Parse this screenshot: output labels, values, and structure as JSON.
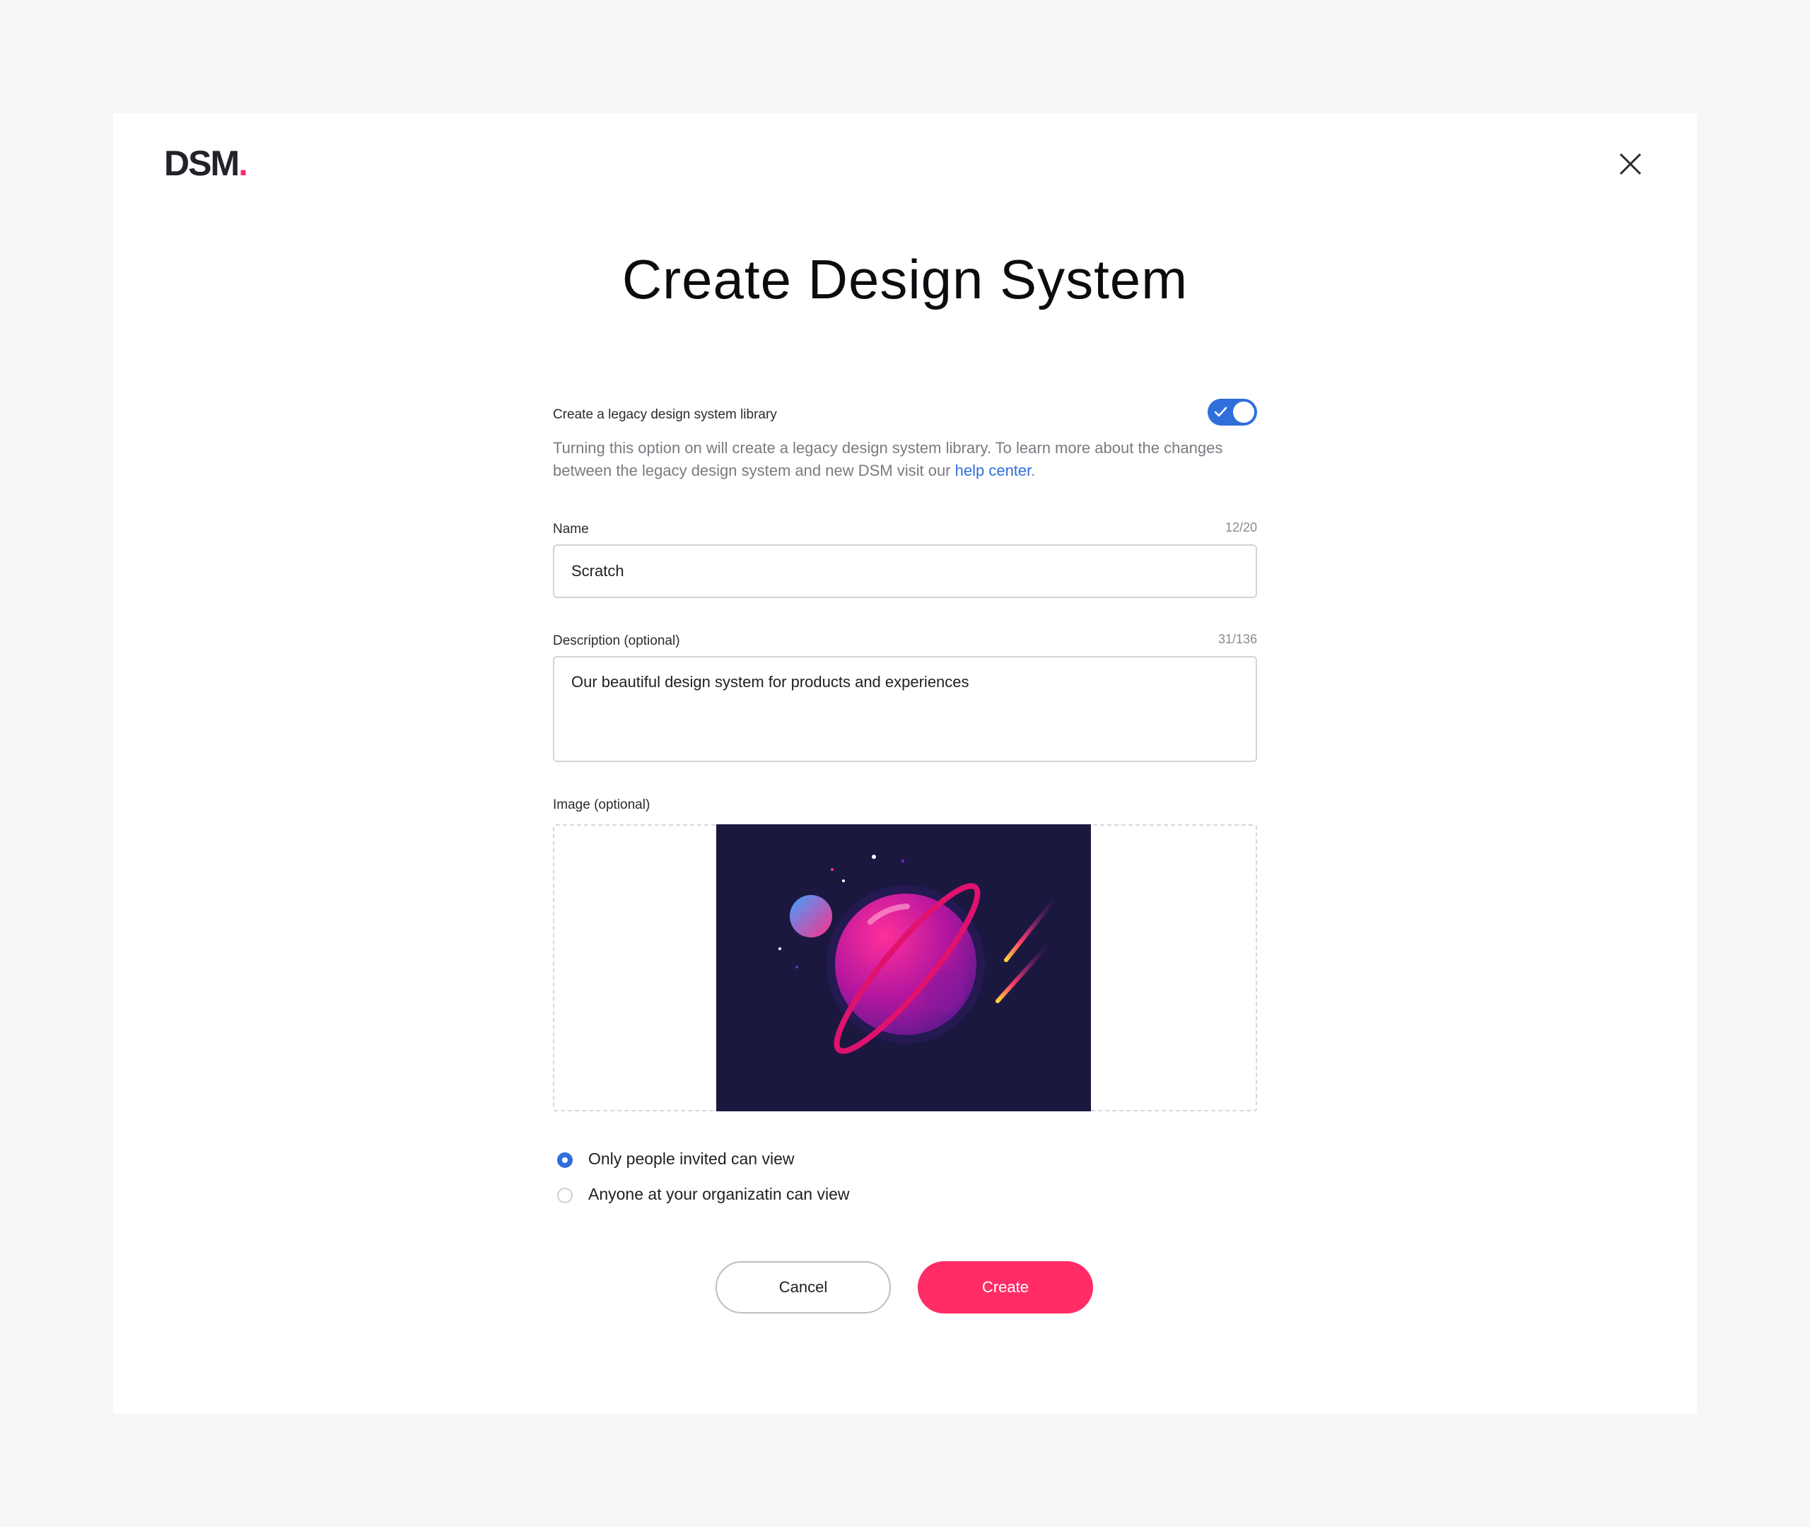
{
  "brand": {
    "logo_text": "DSM",
    "logo_dot": ".",
    "accent": "#ff2d6c"
  },
  "dialog": {
    "title": "Create Design System",
    "close_icon": "close-icon"
  },
  "legacy": {
    "label": "Create a legacy design system library",
    "enabled": true,
    "helper_text": "Turning this option on will create a legacy design system library. To learn more about the changes between the legacy design system and new DSM visit our ",
    "help_link": "help center",
    "helper_suffix": "."
  },
  "name_field": {
    "label": "Name",
    "counter": "12/20",
    "value": "Scratch"
  },
  "description_field": {
    "label": "Description (optional)",
    "counter": "31/136",
    "value": "Our beautiful design system for products and experiences"
  },
  "image_field": {
    "label": "Image (optional)"
  },
  "visibility": {
    "options": [
      {
        "label": "Only people invited can view",
        "selected": true
      },
      {
        "label": "Anyone at your organizatin can view",
        "selected": false
      }
    ]
  },
  "actions": {
    "cancel_label": "Cancel",
    "create_label": "Create"
  },
  "colors": {
    "primary_blue": "#2f6fdb",
    "create_button": "#ff2c66",
    "preview_bg": "#1b1840"
  }
}
